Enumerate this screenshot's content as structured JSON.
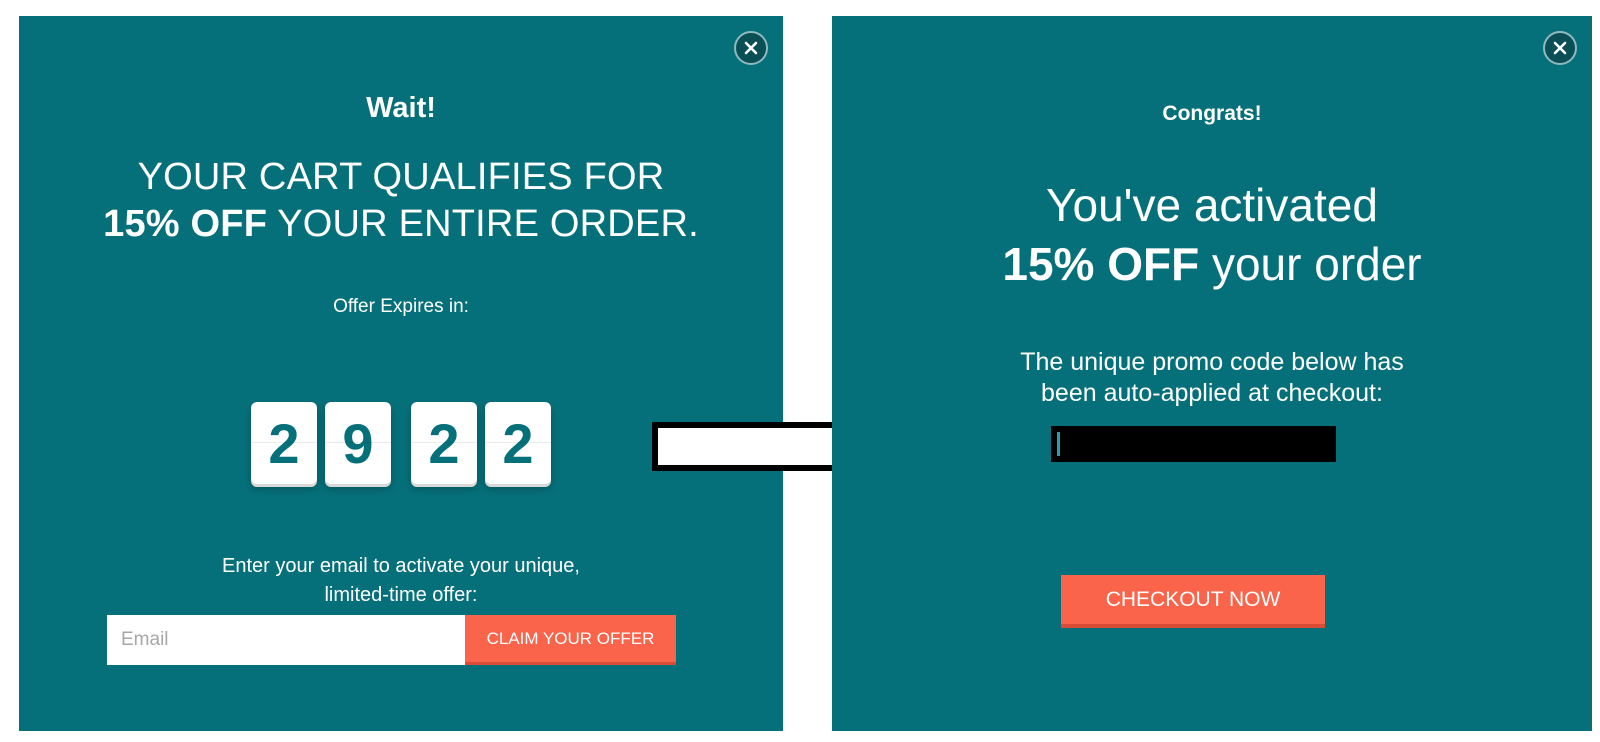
{
  "left_popup": {
    "close_icon": "close-icon",
    "title": "Wait!",
    "headline_line1": "YOUR CART QUALIFIES FOR",
    "headline_bold": "15% OFF",
    "headline_rest": "YOUR ENTIRE ORDER.",
    "expires_label": "Offer Expires in:",
    "countdown_digits": [
      "2",
      "9",
      "2",
      "2"
    ],
    "email_prompt_line1": "Enter your email to activate your unique,",
    "email_prompt_line2": "limited-time offer:",
    "email_placeholder": "Email",
    "claim_button": "CLAIM YOUR OFFER"
  },
  "right_popup": {
    "close_icon": "close-icon",
    "title": "Congrats!",
    "headline_line1": "You've activated",
    "headline_bold": "15% OFF",
    "headline_rest": "your order",
    "promo_line1": "The unique promo code below has",
    "promo_line2": "been auto-applied at checkout:",
    "checkout_button": "CHECKOUT NOW"
  },
  "colors": {
    "panel_bg": "#06707a",
    "accent_button": "#f9644b",
    "text": "#ffffff"
  }
}
